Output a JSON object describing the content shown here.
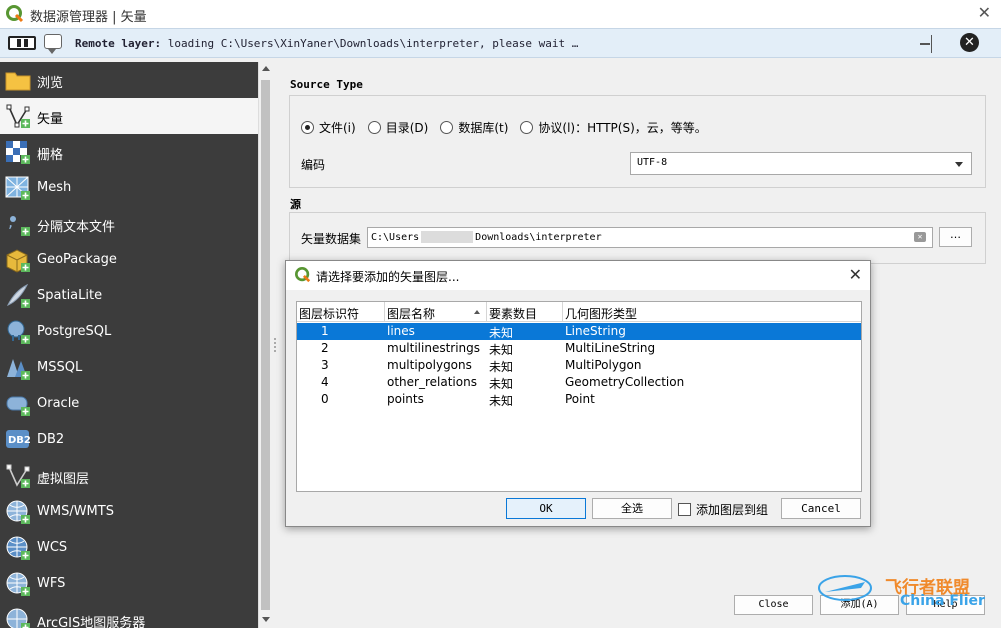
{
  "window": {
    "title": "数据源管理器 | 矢量"
  },
  "message_bar": {
    "title": "Remote layer:",
    "message": "loading C:\\Users\\XinYaner\\Downloads\\interpreter, please wait …"
  },
  "sidebar": {
    "items": [
      {
        "label": "浏览",
        "icon": "folder-icon"
      },
      {
        "label": "矢量",
        "icon": "vector-icon",
        "active": true
      },
      {
        "label": "栅格",
        "icon": "raster-icon"
      },
      {
        "label": "Mesh",
        "icon": "mesh-icon"
      },
      {
        "label": "分隔文本文件",
        "icon": "delimited-text-icon"
      },
      {
        "label": "GeoPackage",
        "icon": "geopackage-icon"
      },
      {
        "label": "SpatiaLite",
        "icon": "spatialite-icon"
      },
      {
        "label": "PostgreSQL",
        "icon": "postgresql-icon"
      },
      {
        "label": "MSSQL",
        "icon": "mssql-icon"
      },
      {
        "label": "Oracle",
        "icon": "oracle-icon"
      },
      {
        "label": "DB2",
        "icon": "db2-icon"
      },
      {
        "label": "虚拟图层",
        "icon": "virtual-layer-icon"
      },
      {
        "label": "WMS/WMTS",
        "icon": "wms-icon"
      },
      {
        "label": "WCS",
        "icon": "wcs-icon"
      },
      {
        "label": "WFS",
        "icon": "wfs-icon"
      },
      {
        "label": "ArcGIS地图服务器",
        "icon": "arcgis-icon"
      }
    ]
  },
  "source_type": {
    "title": "Source Type",
    "options": [
      {
        "label": "文件(i)",
        "checked": true
      },
      {
        "label": "目录(D)",
        "checked": false
      },
      {
        "label": "数据库(t)",
        "checked": false
      },
      {
        "label": "协议(l)：HTTP(S)，云，等等。",
        "checked": false
      }
    ],
    "encoding_label": "编码",
    "encoding_value": "UTF-8"
  },
  "source": {
    "title": "源",
    "dataset_label": "矢量数据集",
    "path_prefix": "C:\\Users",
    "path_suffix": "Downloads\\interpreter",
    "browse_label": "…"
  },
  "footer": {
    "close_label": "Close",
    "add_label": "添加(A)",
    "help_label": "Help"
  },
  "dialog": {
    "title": "请选择要添加的矢量图层...",
    "columns": [
      "图层标识符",
      "图层名称",
      "要素数目",
      "几何图形类型"
    ],
    "rows": [
      {
        "id": "1",
        "name": "lines",
        "count": "未知",
        "geom": "LineString",
        "selected": true
      },
      {
        "id": "2",
        "name": "multilinestrings",
        "count": "未知",
        "geom": "MultiLineString"
      },
      {
        "id": "3",
        "name": "multipolygons",
        "count": "未知",
        "geom": "MultiPolygon"
      },
      {
        "id": "4",
        "name": "other_relations",
        "count": "未知",
        "geom": "GeometryCollection"
      },
      {
        "id": "0",
        "name": "points",
        "count": "未知",
        "geom": "Point"
      }
    ],
    "ok_label": "OK",
    "select_all_label": "全选",
    "add_to_group_label": "添加图层到组",
    "cancel_label": "Cancel"
  },
  "watermark": {
    "text": "飞行者联盟",
    "sub": "China Flier"
  },
  "colors": {
    "sidebar_bg": "#3c3c3c",
    "selection": "#0a78d7",
    "message_bar_bg": "#e3eef8"
  }
}
